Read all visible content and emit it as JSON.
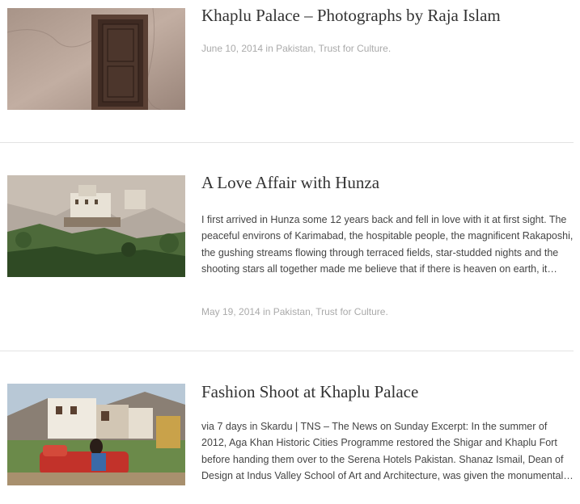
{
  "posts": [
    {
      "title": "Khaplu Palace – Photographs by Raja Islam",
      "image_alt": "Carved wooden door in plaster wall",
      "date": "June 10, 2014",
      "in_text": " in ",
      "categories": [
        "Pakistan",
        "Trust for Culture"
      ],
      "sep": ", ",
      "end": "."
    },
    {
      "title": "A Love Affair with Hunza",
      "image_alt": "Baltit Fort above terraced fields in Hunza",
      "excerpt": "I first arrived in Hunza some 12 years back and fell in love with it at first sight. The peaceful environs of Karimabad, the hospitable people, the magnificent Rakaposhi, the gushing streams flowing through terraced fields, star-studded nights and the shooting stars all together made me believe that if there is heaven on earth, it…",
      "date": "May 19, 2014",
      "in_text": " in ",
      "categories": [
        "Pakistan",
        "Trust for Culture"
      ],
      "sep": ", ",
      "end": "."
    },
    {
      "title": "Fashion Shoot at Khaplu Palace",
      "image_alt": "Model seated in front of Khaplu Palace",
      "excerpt": "via 7 days in Skardu | TNS – The News on Sunday Excerpt: In the summer of 2012, Aga Khan Historic Cities Programme restored the Shigar and Khaplu Fort before handing them over to the Serena Hotels Pakistan. Shanaz Ismail, Dean of Design at Indus Valley School of Art and Architecture, was given the monumental…"
    }
  ],
  "colors": {
    "title": "#333333",
    "text": "#444444",
    "meta": "#aaaaaa",
    "divider": "#e3e3e3"
  }
}
